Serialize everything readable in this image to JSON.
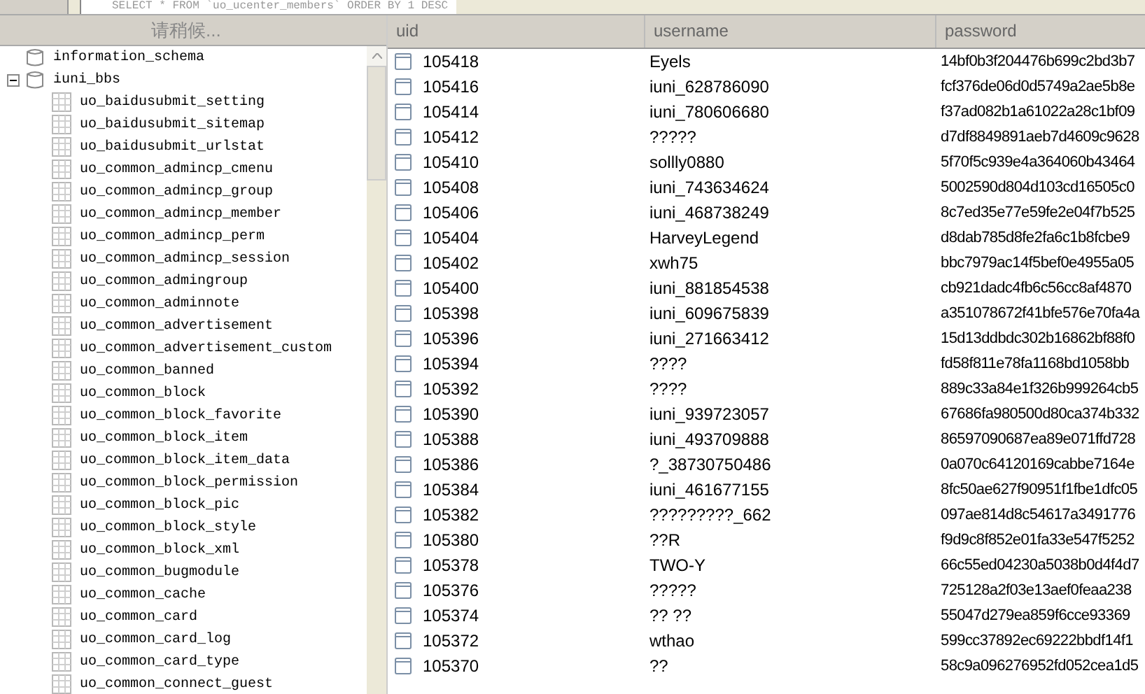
{
  "query_bar": {
    "sql": "SELECT * FROM `uo_ucenter_members` ORDER BY 1 DESC"
  },
  "sidebar": {
    "status": "请稍候...",
    "items": [
      {
        "name": "information_schema",
        "kind": "database"
      },
      {
        "name": "iuni_bbs",
        "kind": "database",
        "expanded": true,
        "children": [
          {
            "name": "uo_baidusubmit_setting",
            "kind": "table"
          },
          {
            "name": "uo_baidusubmit_sitemap",
            "kind": "table"
          },
          {
            "name": "uo_baidusubmit_urlstat",
            "kind": "table"
          },
          {
            "name": "uo_common_admincp_cmenu",
            "kind": "table"
          },
          {
            "name": "uo_common_admincp_group",
            "kind": "table"
          },
          {
            "name": "uo_common_admincp_member",
            "kind": "table"
          },
          {
            "name": "uo_common_admincp_perm",
            "kind": "table"
          },
          {
            "name": "uo_common_admincp_session",
            "kind": "table"
          },
          {
            "name": "uo_common_admingroup",
            "kind": "table"
          },
          {
            "name": "uo_common_adminnote",
            "kind": "table"
          },
          {
            "name": "uo_common_advertisement",
            "kind": "table"
          },
          {
            "name": "uo_common_advertisement_custom",
            "kind": "table"
          },
          {
            "name": "uo_common_banned",
            "kind": "table"
          },
          {
            "name": "uo_common_block",
            "kind": "table"
          },
          {
            "name": "uo_common_block_favorite",
            "kind": "table"
          },
          {
            "name": "uo_common_block_item",
            "kind": "table"
          },
          {
            "name": "uo_common_block_item_data",
            "kind": "table"
          },
          {
            "name": "uo_common_block_permission",
            "kind": "table"
          },
          {
            "name": "uo_common_block_pic",
            "kind": "table"
          },
          {
            "name": "uo_common_block_style",
            "kind": "table"
          },
          {
            "name": "uo_common_block_xml",
            "kind": "table"
          },
          {
            "name": "uo_common_bugmodule",
            "kind": "table"
          },
          {
            "name": "uo_common_cache",
            "kind": "table"
          },
          {
            "name": "uo_common_card",
            "kind": "table"
          },
          {
            "name": "uo_common_card_log",
            "kind": "table"
          },
          {
            "name": "uo_common_card_type",
            "kind": "table"
          },
          {
            "name": "uo_common_connect_guest",
            "kind": "table"
          }
        ]
      }
    ]
  },
  "table": {
    "columns": [
      "uid",
      "username",
      "password"
    ],
    "rows": [
      {
        "uid": "105418",
        "username": "Eyels",
        "password": "14bf0b3f204476b699c2bd3b7"
      },
      {
        "uid": "105416",
        "username": "iuni_628786090",
        "password": "fcf376de06d0d5749a2ae5b8e"
      },
      {
        "uid": "105414",
        "username": "iuni_780606680",
        "password": "f37ad082b1a61022a28c1bf09"
      },
      {
        "uid": "105412",
        "username": "?????",
        "password": "d7df8849891aeb7d4609c9628"
      },
      {
        "uid": "105410",
        "username": "sollly0880",
        "password": "5f70f5c939e4a364060b43464"
      },
      {
        "uid": "105408",
        "username": "iuni_743634624",
        "password": "5002590d804d103cd16505c0"
      },
      {
        "uid": "105406",
        "username": "iuni_468738249",
        "password": "8c7ed35e77e59fe2e04f7b525"
      },
      {
        "uid": "105404",
        "username": "HarveyLegend",
        "password": "d8dab785d8fe2fa6c1b8fcbe9"
      },
      {
        "uid": "105402",
        "username": "xwh75",
        "password": "bbc7979ac14f5bef0e4955a05"
      },
      {
        "uid": "105400",
        "username": "iuni_881854538",
        "password": "cb921dadc4fb6c56cc8af4870"
      },
      {
        "uid": "105398",
        "username": "iuni_609675839",
        "password": "a351078672f41bfe576e70fa4a"
      },
      {
        "uid": "105396",
        "username": "iuni_271663412",
        "password": "15d13ddbdc302b16862bf88f0"
      },
      {
        "uid": "105394",
        "username": "????",
        "password": "fd58f811e78fa1168bd1058bb"
      },
      {
        "uid": "105392",
        "username": "????",
        "password": "889c33a84e1f326b999264cb5"
      },
      {
        "uid": "105390",
        "username": "iuni_939723057",
        "password": "67686fa980500d80ca374b332"
      },
      {
        "uid": "105388",
        "username": "iuni_493709888",
        "password": "86597090687ea89e071ffd728"
      },
      {
        "uid": "105386",
        "username": "?_38730750486",
        "password": "0a070c64120169cabbe7164e"
      },
      {
        "uid": "105384",
        "username": "iuni_461677155",
        "password": "8fc50ae627f90951f1fbe1dfc05"
      },
      {
        "uid": "105382",
        "username": "?????????_662",
        "password": "097ae814d8c54617a3491776"
      },
      {
        "uid": "105380",
        "username": "??R",
        "password": "f9d9c8f852e01fa33e547f5252"
      },
      {
        "uid": "105378",
        "username": "TWO-Y",
        "password": "66c55ed04230a5038b0d4f4d7"
      },
      {
        "uid": "105376",
        "username": "?????",
        "password": "725128a2f03e13aef0feaa238"
      },
      {
        "uid": "105374",
        "username": "?? ??",
        "password": "55047d279ea859f6cce93369"
      },
      {
        "uid": "105372",
        "username": "wthao",
        "password": "599cc37892ec69222bbdf14f1"
      },
      {
        "uid": "105370",
        "username": "??",
        "password": "58c9a096276952fd052cea1d5"
      }
    ]
  }
}
